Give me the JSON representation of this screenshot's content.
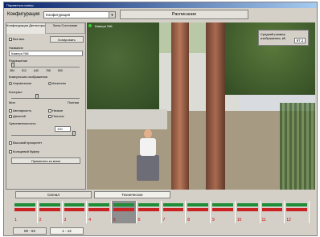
{
  "window": {
    "title": "Параметры камер"
  },
  "topbar": {
    "config_label": "Конфигурация",
    "config_value": "Конфигурация",
    "schedule_tab": "Расписание"
  },
  "left": {
    "tab_config": "Конфигурация Детекторы",
    "tab_zones": "Зоны Состояние",
    "chk_all": "Все вкл.",
    "btn_copy": "Копировать",
    "name_label": "Название",
    "name_value": "Камера №5",
    "resolution_label": "Разрешение",
    "resolution_ticks": [
      "384",
      "512",
      "640",
      "768",
      "800"
    ],
    "compression_label": "Компрессия изображения",
    "opt_normal": "Нормальное",
    "opt_quality": "Качество",
    "brightness_label": "Контраст",
    "low": "Мин",
    "high": "Полная",
    "chk_auto": "Автояркость",
    "chk_extra": "Низкое",
    "chk_display": "Дисплей",
    "chk_bars": "Полосы",
    "sensitivity_label": "Чувствительность",
    "sensitivity_value": "100",
    "chk_high_priority": "Высокий приоритет",
    "chk_buffer": "Кольцевой буфер",
    "btn_apply": "Применить ко всем"
  },
  "video": {
    "camera_label": "Камера №5",
    "size_label": "Средний размер изображения, кБ",
    "size_value": "97.2"
  },
  "bottom": {
    "tab_common": "Сигнал",
    "tab_tech": "Техническое"
  },
  "channels": [
    "1",
    "2",
    "3",
    "4",
    "5",
    "6",
    "7",
    "8",
    "9",
    "10",
    "11",
    "12"
  ],
  "pager": {
    "p1": "00 - 52",
    "p2": "1 - 12"
  }
}
